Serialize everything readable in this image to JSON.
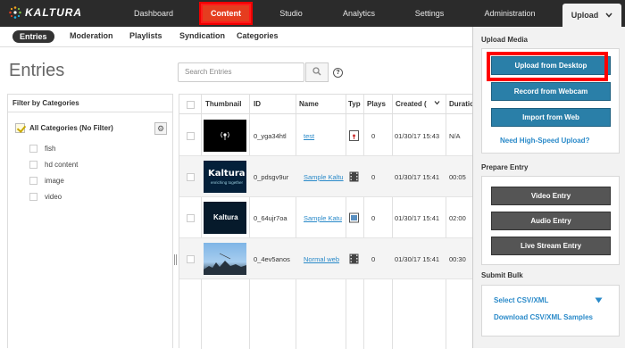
{
  "app": {
    "logo": "KALTURA"
  },
  "nav": {
    "dashboard": "Dashboard",
    "content": "Content",
    "studio": "Studio",
    "analytics": "Analytics",
    "settings": "Settings",
    "administration": "Administration",
    "upload": "Upload"
  },
  "subnav": {
    "entries": "Entries",
    "moderation": "Moderation",
    "playlists": "Playlists",
    "syndication": "Syndication",
    "categories": "Categories"
  },
  "page": {
    "title": "Entries",
    "search_placeholder": "Search Entries",
    "help": "?"
  },
  "filter": {
    "title": "Filter by Categories",
    "all": "All Categories (No Filter)",
    "items": [
      "fish",
      "hd content",
      "image",
      "video"
    ]
  },
  "table": {
    "headers": {
      "thumbnail": "Thumbnail",
      "id": "ID",
      "name": "Name",
      "type": "Typ",
      "plays": "Plays",
      "created": "Created (",
      "duration": "Duratio"
    },
    "rows": [
      {
        "id": "0_yga34htl",
        "name": "test",
        "plays": "0",
        "created": "01/30/17 15:43",
        "duration": "N/A"
      },
      {
        "id": "0_pdsgv9ur",
        "name": "Sample Kaltu",
        "plays": "0",
        "created": "01/30/17 15:41",
        "duration": "00:05"
      },
      {
        "id": "0_64ujr7oa",
        "name": "Sample Katu",
        "plays": "0",
        "created": "01/30/17 15:41",
        "duration": "02:00"
      },
      {
        "id": "0_4ev5anos",
        "name": "Normal web",
        "plays": "0",
        "created": "01/30/17 15:41",
        "duration": "00:30"
      }
    ],
    "thumb_texts": {
      "kaltura": "Kaltura",
      "kaltura_sub": "enriching together",
      "kaltura2": "Kaltura"
    }
  },
  "panel": {
    "upload_media": "Upload Media",
    "upload_desktop": "Upload from Desktop",
    "record_webcam": "Record from Webcam",
    "import_web": "Import from Web",
    "high_speed": "Need High-Speed Upload?",
    "prepare_entry": "Prepare Entry",
    "video_entry": "Video Entry",
    "audio_entry": "Audio Entry",
    "live_entry": "Live Stream Entry",
    "submit_bulk": "Submit Bulk",
    "select_csv": "Select CSV/XML",
    "download_csv": "Download CSV/XML Samples"
  },
  "colors": {
    "topbar": "#2b2b2b",
    "accent_red": "#e53d1f",
    "highlight": "#ff0000",
    "blue_button": "#2a7fa8",
    "link": "#2a8ac9"
  }
}
